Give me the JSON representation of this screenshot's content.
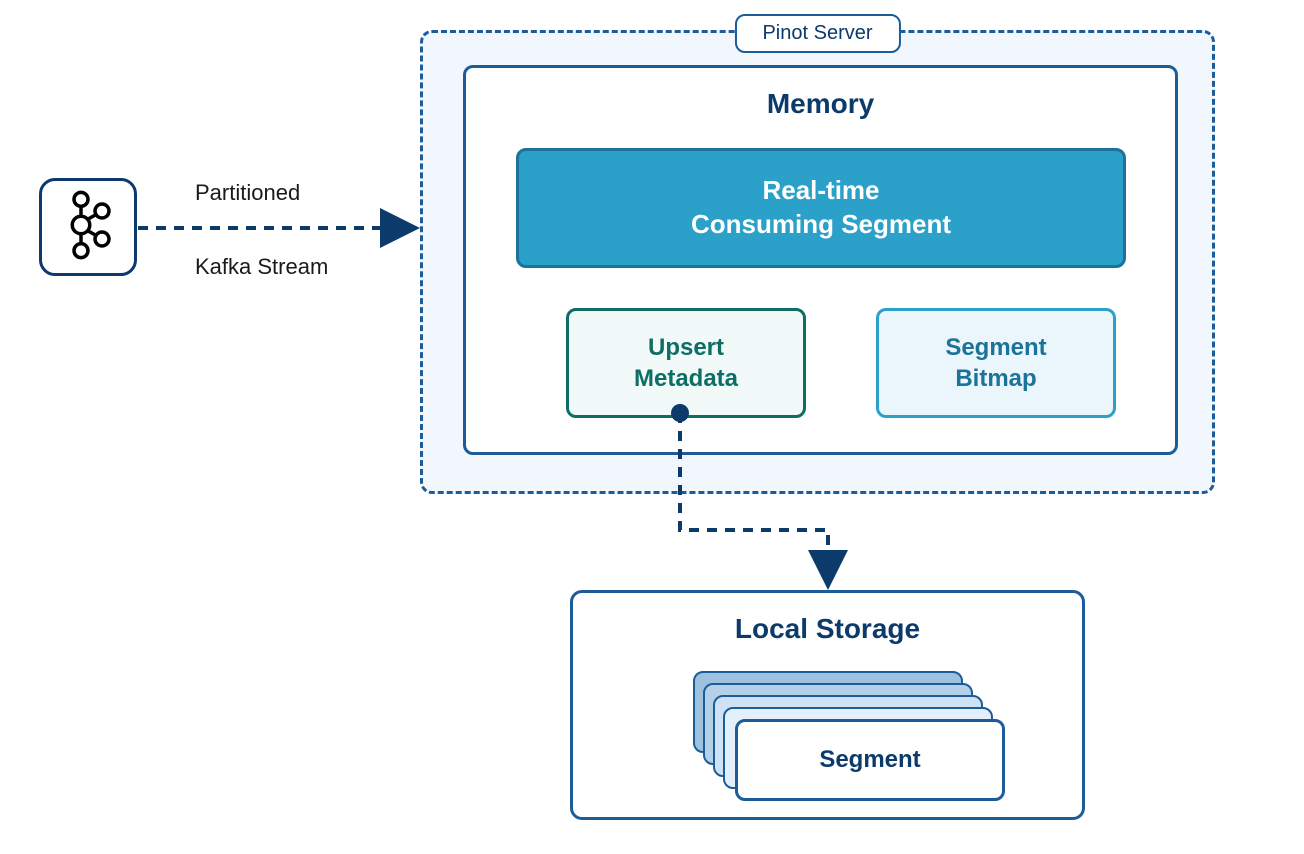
{
  "stream": {
    "label_top": "Partitioned",
    "label_bottom": "Kafka Stream"
  },
  "pinot": {
    "label": "Pinot Server",
    "memory": {
      "title": "Memory",
      "realtime": {
        "line1": "Real-time",
        "line2": "Consuming Segment"
      },
      "upsert": {
        "line1": "Upsert",
        "line2": "Metadata"
      },
      "bitmap": {
        "line1": "Segment",
        "line2": "Bitmap"
      }
    }
  },
  "storage": {
    "title": "Local Storage",
    "segment_label": "Segment"
  }
}
